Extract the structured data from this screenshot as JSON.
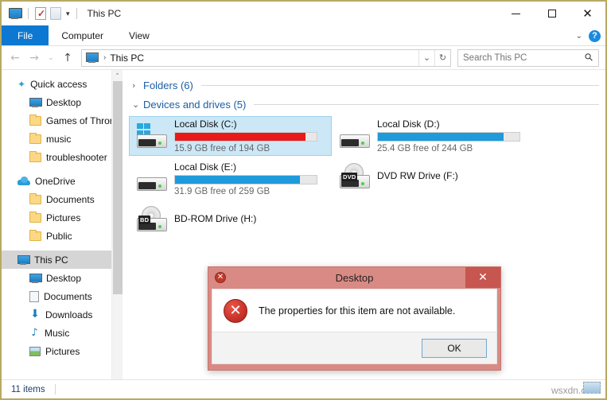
{
  "window": {
    "title": "This PC",
    "border_color": "#b9a961",
    "quick_access": [
      {
        "name": "this-pc-icon",
        "label": "This PC"
      },
      {
        "name": "properties-icon",
        "label": "Properties"
      },
      {
        "name": "new-folder-icon",
        "label": "New folder"
      },
      {
        "name": "customize-chevron-icon",
        "label": "▾"
      }
    ],
    "controls": {
      "minimize": "—",
      "maximize": "□",
      "close": "✕"
    }
  },
  "ribbon": {
    "tabs": [
      {
        "label": "File",
        "active_style": "file"
      },
      {
        "label": "Computer",
        "active_style": "normal"
      },
      {
        "label": "View",
        "active_style": "normal"
      }
    ],
    "collapse_chevron": "⌄",
    "help_label": "?",
    "accent_color": "#0d78d1"
  },
  "navbar": {
    "back": "←",
    "forward": "→",
    "recent": "⌄",
    "up": "↑",
    "breadcrumb": "This PC",
    "breadcrumb_separator": "›",
    "dropdown": "⌄",
    "refresh": "↻"
  },
  "search": {
    "placeholder": "Search This PC",
    "icon": "search-icon",
    "value": ""
  },
  "sidebar": {
    "items": [
      {
        "label": "Quick access",
        "icon": "star-icon",
        "level": 0,
        "selected": false
      },
      {
        "label": "Desktop",
        "icon": "desktop-icon",
        "level": 1,
        "selected": false
      },
      {
        "label": "Games of Thron",
        "icon": "folder-icon",
        "level": 1,
        "selected": false
      },
      {
        "label": "music",
        "icon": "folder-icon",
        "level": 1,
        "selected": false
      },
      {
        "label": "troubleshooter",
        "icon": "folder-icon",
        "level": 1,
        "selected": false
      },
      {
        "label": "OneDrive",
        "icon": "cloud-icon",
        "level": 0,
        "selected": false
      },
      {
        "label": "Documents",
        "icon": "folder-icon",
        "level": 1,
        "selected": false
      },
      {
        "label": "Pictures",
        "icon": "folder-icon",
        "level": 1,
        "selected": false
      },
      {
        "label": "Public",
        "icon": "folder-icon",
        "level": 1,
        "selected": false
      },
      {
        "label": "This PC",
        "icon": "desktop-icon",
        "level": 0,
        "selected": true
      },
      {
        "label": "Desktop",
        "icon": "desktop-icon",
        "level": 1,
        "selected": false
      },
      {
        "label": "Documents",
        "icon": "document-icon",
        "level": 1,
        "selected": false
      },
      {
        "label": "Downloads",
        "icon": "download-icon",
        "level": 1,
        "selected": false
      },
      {
        "label": "Music",
        "icon": "music-icon",
        "level": 1,
        "selected": false
      },
      {
        "label": "Pictures",
        "icon": "picture-icon",
        "level": 1,
        "selected": false
      }
    ],
    "scroll_up": "⌃",
    "scroll_down": "⌄"
  },
  "content": {
    "groups": [
      {
        "title": "Folders (6)",
        "chevron": "›",
        "expanded": false
      },
      {
        "title": "Devices and drives (5)",
        "chevron": "⌄",
        "expanded": true
      }
    ],
    "drives": [
      {
        "name": "Local Disk (C:)",
        "sub": "15.9 GB free of 194 GB",
        "bar_percent": 92,
        "bar_color": "#e61c1c",
        "icon": "windows-drive-icon",
        "selected": true,
        "has_bar": true
      },
      {
        "name": "Local Disk (D:)",
        "sub": "25.4 GB free of 244 GB",
        "bar_percent": 89,
        "bar_color": "#1f9ada",
        "icon": "drive-icon",
        "selected": false,
        "has_bar": true
      },
      {
        "name": "Local Disk (E:)",
        "sub": "31.9 GB free of 259 GB",
        "bar_percent": 88,
        "bar_color": "#1f9ada",
        "icon": "drive-icon",
        "selected": false,
        "has_bar": true
      },
      {
        "name": "DVD RW Drive (F:)",
        "sub": "",
        "bar_percent": 0,
        "bar_color": "",
        "icon": "dvd-drive-icon",
        "disc_tag": "DVD",
        "selected": false,
        "has_bar": false
      },
      {
        "name": "BD-ROM Drive (H:)",
        "sub": "",
        "bar_percent": 0,
        "bar_color": "",
        "icon": "bd-drive-icon",
        "disc_tag": "BD",
        "selected": false,
        "has_bar": false
      }
    ]
  },
  "statusbar": {
    "item_count": "11 items",
    "watermark": "wsxdn.com"
  },
  "dialog": {
    "title": "Desktop",
    "message": "The properties for this item are not available.",
    "ok_label": "OK",
    "close_glyph": "✕",
    "title_icon_glyph": "✕",
    "error_icon_glyph": "✕",
    "titlebar_color": "#d98a84",
    "close_button_color": "#c75550"
  }
}
